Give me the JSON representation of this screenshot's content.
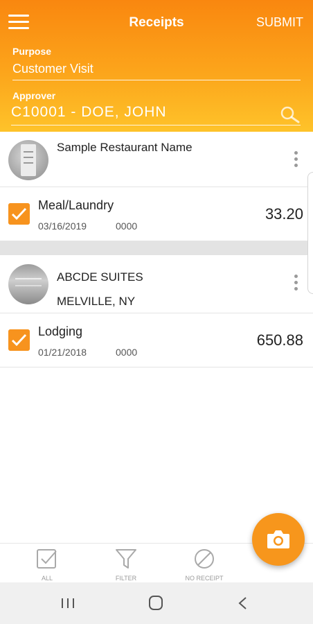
{
  "header": {
    "title": "Receipts",
    "submit_label": "SUBMIT",
    "purpose_label": "Purpose",
    "purpose_value": "Customer Visit",
    "approver_label": "Approver",
    "approver_value": "C10001 - DOE, JOHN"
  },
  "receipts": [
    {
      "merchant": "Sample Restaurant Name",
      "location": "",
      "expense": {
        "type": "Meal/Laundry",
        "date": "03/16/2019",
        "code": "0000",
        "amount": "33.20",
        "checked": true
      }
    },
    {
      "merchant": "ABCDE SUITES",
      "location": "MELVILLE, NY",
      "expense": {
        "type": "Lodging",
        "date": "01/21/2018",
        "code": "0000",
        "amount": "650.88",
        "checked": true
      }
    }
  ],
  "bottom_bar": {
    "all_label": "ALL",
    "filter_label": "FILTER",
    "no_receipt_label": "NO RECEIPT"
  },
  "icons": {
    "menu": "hamburger-menu-icon",
    "search": "search-icon",
    "more": "more-vertical-icon",
    "check": "checkbox-checked-icon",
    "camera": "camera-icon",
    "filter": "filter-icon",
    "no_receipt": "no-receipt-icon"
  },
  "colors": {
    "accent": "#f7931e",
    "header_top": "#f9870f",
    "header_bottom": "#fec32a"
  }
}
